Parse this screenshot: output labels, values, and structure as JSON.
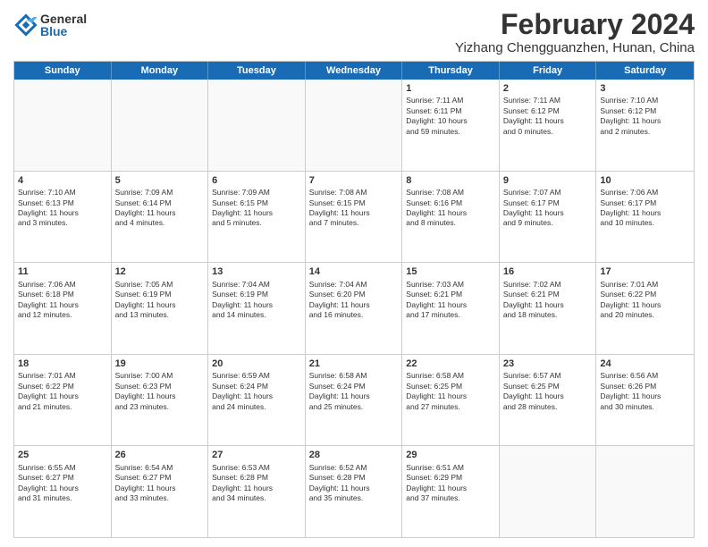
{
  "logo": {
    "general": "General",
    "blue": "Blue"
  },
  "title": {
    "month_year": "February 2024",
    "location": "Yizhang Chengguanzhen, Hunan, China"
  },
  "header_days": [
    "Sunday",
    "Monday",
    "Tuesday",
    "Wednesday",
    "Thursday",
    "Friday",
    "Saturday"
  ],
  "weeks": [
    [
      {
        "day": "",
        "info": ""
      },
      {
        "day": "",
        "info": ""
      },
      {
        "day": "",
        "info": ""
      },
      {
        "day": "",
        "info": ""
      },
      {
        "day": "1",
        "info": "Sunrise: 7:11 AM\nSunset: 6:11 PM\nDaylight: 10 hours\nand 59 minutes."
      },
      {
        "day": "2",
        "info": "Sunrise: 7:11 AM\nSunset: 6:12 PM\nDaylight: 11 hours\nand 0 minutes."
      },
      {
        "day": "3",
        "info": "Sunrise: 7:10 AM\nSunset: 6:12 PM\nDaylight: 11 hours\nand 2 minutes."
      }
    ],
    [
      {
        "day": "4",
        "info": "Sunrise: 7:10 AM\nSunset: 6:13 PM\nDaylight: 11 hours\nand 3 minutes."
      },
      {
        "day": "5",
        "info": "Sunrise: 7:09 AM\nSunset: 6:14 PM\nDaylight: 11 hours\nand 4 minutes."
      },
      {
        "day": "6",
        "info": "Sunrise: 7:09 AM\nSunset: 6:15 PM\nDaylight: 11 hours\nand 5 minutes."
      },
      {
        "day": "7",
        "info": "Sunrise: 7:08 AM\nSunset: 6:15 PM\nDaylight: 11 hours\nand 7 minutes."
      },
      {
        "day": "8",
        "info": "Sunrise: 7:08 AM\nSunset: 6:16 PM\nDaylight: 11 hours\nand 8 minutes."
      },
      {
        "day": "9",
        "info": "Sunrise: 7:07 AM\nSunset: 6:17 PM\nDaylight: 11 hours\nand 9 minutes."
      },
      {
        "day": "10",
        "info": "Sunrise: 7:06 AM\nSunset: 6:17 PM\nDaylight: 11 hours\nand 10 minutes."
      }
    ],
    [
      {
        "day": "11",
        "info": "Sunrise: 7:06 AM\nSunset: 6:18 PM\nDaylight: 11 hours\nand 12 minutes."
      },
      {
        "day": "12",
        "info": "Sunrise: 7:05 AM\nSunset: 6:19 PM\nDaylight: 11 hours\nand 13 minutes."
      },
      {
        "day": "13",
        "info": "Sunrise: 7:04 AM\nSunset: 6:19 PM\nDaylight: 11 hours\nand 14 minutes."
      },
      {
        "day": "14",
        "info": "Sunrise: 7:04 AM\nSunset: 6:20 PM\nDaylight: 11 hours\nand 16 minutes."
      },
      {
        "day": "15",
        "info": "Sunrise: 7:03 AM\nSunset: 6:21 PM\nDaylight: 11 hours\nand 17 minutes."
      },
      {
        "day": "16",
        "info": "Sunrise: 7:02 AM\nSunset: 6:21 PM\nDaylight: 11 hours\nand 18 minutes."
      },
      {
        "day": "17",
        "info": "Sunrise: 7:01 AM\nSunset: 6:22 PM\nDaylight: 11 hours\nand 20 minutes."
      }
    ],
    [
      {
        "day": "18",
        "info": "Sunrise: 7:01 AM\nSunset: 6:22 PM\nDaylight: 11 hours\nand 21 minutes."
      },
      {
        "day": "19",
        "info": "Sunrise: 7:00 AM\nSunset: 6:23 PM\nDaylight: 11 hours\nand 23 minutes."
      },
      {
        "day": "20",
        "info": "Sunrise: 6:59 AM\nSunset: 6:24 PM\nDaylight: 11 hours\nand 24 minutes."
      },
      {
        "day": "21",
        "info": "Sunrise: 6:58 AM\nSunset: 6:24 PM\nDaylight: 11 hours\nand 25 minutes."
      },
      {
        "day": "22",
        "info": "Sunrise: 6:58 AM\nSunset: 6:25 PM\nDaylight: 11 hours\nand 27 minutes."
      },
      {
        "day": "23",
        "info": "Sunrise: 6:57 AM\nSunset: 6:25 PM\nDaylight: 11 hours\nand 28 minutes."
      },
      {
        "day": "24",
        "info": "Sunrise: 6:56 AM\nSunset: 6:26 PM\nDaylight: 11 hours\nand 30 minutes."
      }
    ],
    [
      {
        "day": "25",
        "info": "Sunrise: 6:55 AM\nSunset: 6:27 PM\nDaylight: 11 hours\nand 31 minutes."
      },
      {
        "day": "26",
        "info": "Sunrise: 6:54 AM\nSunset: 6:27 PM\nDaylight: 11 hours\nand 33 minutes."
      },
      {
        "day": "27",
        "info": "Sunrise: 6:53 AM\nSunset: 6:28 PM\nDaylight: 11 hours\nand 34 minutes."
      },
      {
        "day": "28",
        "info": "Sunrise: 6:52 AM\nSunset: 6:28 PM\nDaylight: 11 hours\nand 35 minutes."
      },
      {
        "day": "29",
        "info": "Sunrise: 6:51 AM\nSunset: 6:29 PM\nDaylight: 11 hours\nand 37 minutes."
      },
      {
        "day": "",
        "info": ""
      },
      {
        "day": "",
        "info": ""
      }
    ]
  ]
}
